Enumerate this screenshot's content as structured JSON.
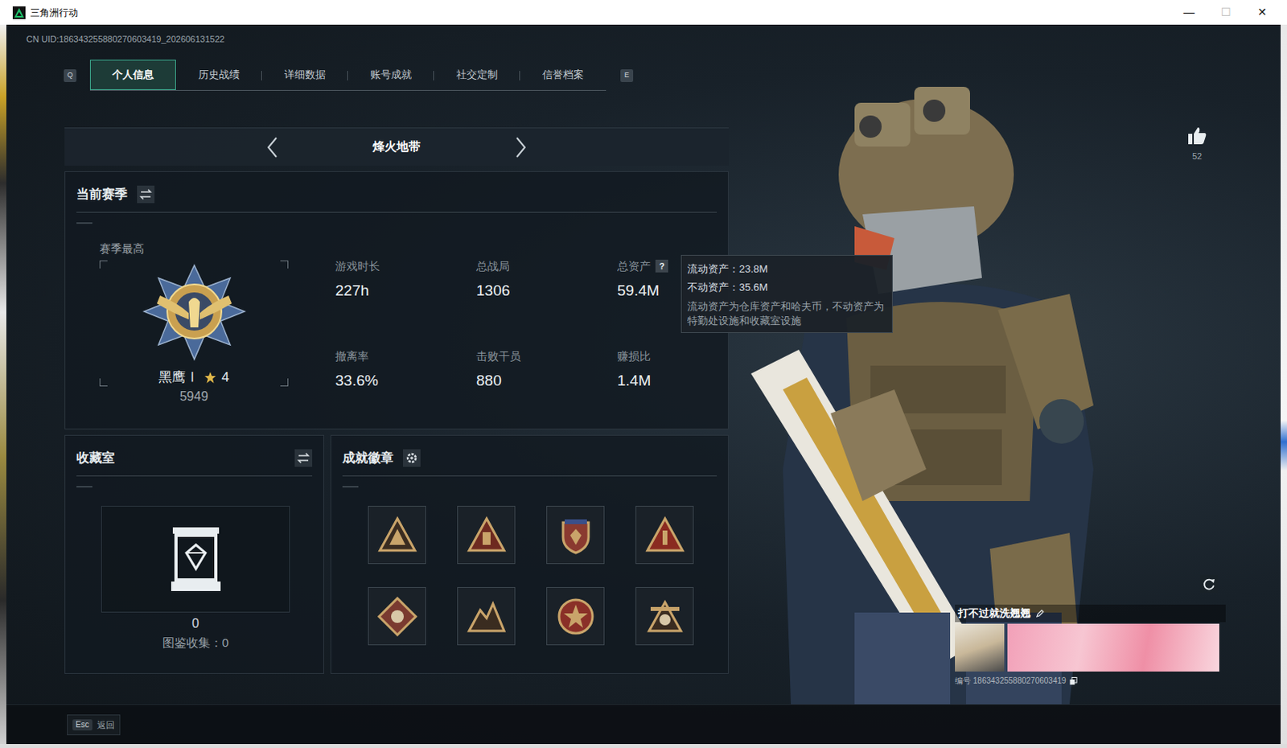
{
  "window": {
    "title": "三角洲行动",
    "controls": [
      {
        "glyph": "—",
        "disabled": false
      },
      {
        "glyph": "☐",
        "disabled": true
      },
      {
        "glyph": "✕",
        "disabled": false
      }
    ]
  },
  "uid": "CN UID:186343255880270603419_202606131522",
  "tabs": {
    "prev_key": "Q",
    "next_key": "E",
    "items": [
      {
        "label": "个人信息",
        "selected": true
      },
      {
        "label": "历史战绩",
        "selected": false
      },
      {
        "label": "详细数据",
        "selected": false
      },
      {
        "label": "账号成就",
        "selected": false
      },
      {
        "label": "社交定制",
        "selected": false
      },
      {
        "label": "信誉档案",
        "selected": false
      }
    ]
  },
  "mode": {
    "label": "烽火地带"
  },
  "season": {
    "title": "当前赛季",
    "best_label": "赛季最高",
    "rank": {
      "name": "黑鹰Ⅰ",
      "star_level": "4",
      "score": "5949"
    },
    "stats": [
      {
        "label": "游戏时长",
        "value": "227h"
      },
      {
        "label": "总战局",
        "value": "1306"
      },
      {
        "label": "总资产",
        "value": "59.4M",
        "help": "?"
      },
      {
        "label": "撤离率",
        "value": "33.6%"
      },
      {
        "label": "击败干员",
        "value": "880"
      },
      {
        "label": "赚损比",
        "value": "1.4M"
      }
    ]
  },
  "tooltip": {
    "lines": [
      "流动资产：23.8M",
      "不动资产：35.6M"
    ],
    "note": "流动资产为仓库资产和哈夫币，不动资产为特勤处设施和收藏室设施"
  },
  "collection": {
    "title": "收藏室",
    "count": "0",
    "catalog": "图鉴收集：0"
  },
  "achievements": {
    "title": "成就徽章",
    "badges": [
      {
        "kind": "triangle"
      },
      {
        "kind": "pyramid"
      },
      {
        "kind": "shield"
      },
      {
        "kind": "warning"
      },
      {
        "kind": "diamond"
      },
      {
        "kind": "mountain"
      },
      {
        "kind": "star"
      },
      {
        "kind": "crest"
      }
    ]
  },
  "profile": {
    "likes": "52",
    "name": "打不过就洗翘翘",
    "id": "编号 186343255880270603419"
  },
  "footer": {
    "key": "Esc",
    "label": "返回"
  }
}
